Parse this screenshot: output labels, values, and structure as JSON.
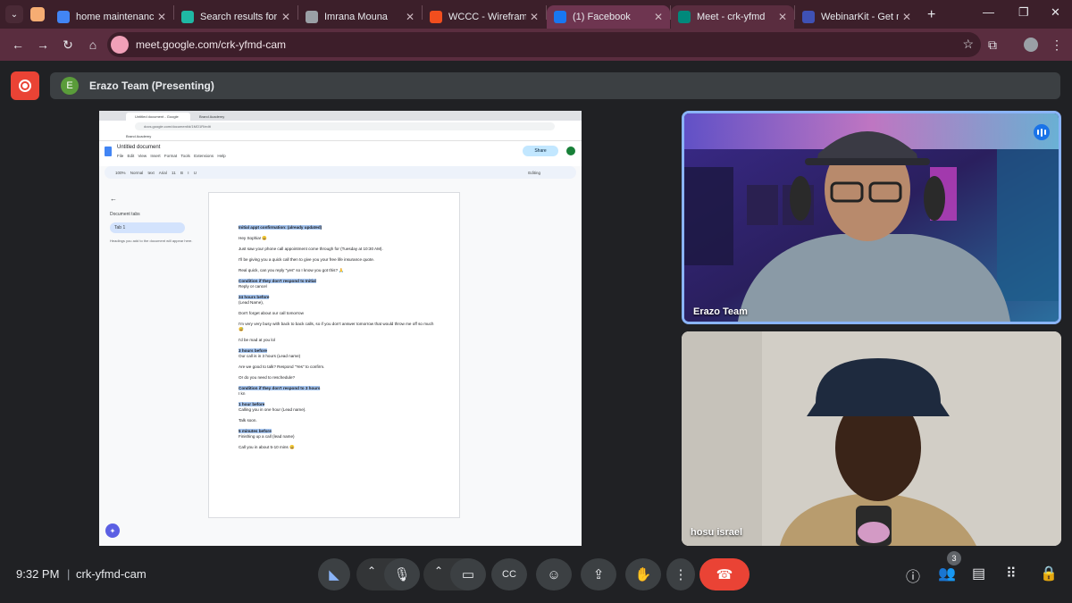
{
  "browser": {
    "tabs": [
      {
        "title": "home maintenance",
        "favicon_color": "#4285f4",
        "state": "normal"
      },
      {
        "title": "Search results for A",
        "favicon_color": "#1fb8a4",
        "state": "normal"
      },
      {
        "title": "Imrana Mouna",
        "favicon_color": "#9aa0a6",
        "state": "normal"
      },
      {
        "title": "WCCC - Wireframe",
        "favicon_color": "#f24e1e",
        "state": "normal"
      },
      {
        "title": "(1) Facebook",
        "favicon_color": "#1877f2",
        "state": "highlighted"
      },
      {
        "title": "Meet - crk-yfmd",
        "favicon_color": "#00897b",
        "state": "active"
      },
      {
        "title": "WebinarKit - Get m",
        "favicon_color": "#3f51b5",
        "state": "normal"
      }
    ],
    "url": "meet.google.com/crk-yfmd-cam"
  },
  "meet": {
    "presenter_initial": "E",
    "presenter_title": "Erazo Team (Presenting)",
    "participants": [
      {
        "name": "Erazo Team",
        "speaking": true
      },
      {
        "name": "hosu israel",
        "speaking": false
      }
    ],
    "time": "9:32 PM",
    "meeting_code": "crk-yfmd-cam",
    "people_count": "3",
    "accent_color": "#8ab4f8",
    "hangup_color": "#ea4335"
  },
  "shared_doc": {
    "browser_tabs": [
      "Untitled document - Google",
      "Brand Academy"
    ],
    "url": "docs.google.com/document/d/1MO1R/edit",
    "bookmark": "Brand Academy",
    "doc_title": "Untitled document",
    "menus": "File Edit View Insert Format Tools Extensions Help",
    "toolbar": "100%  Normal text  Arial  11  B I U",
    "share_label": "Share",
    "editing_label": "Editing",
    "side_tabs_label": "Document tabs",
    "side_tab": "Tab 1",
    "side_hint": "Headings you add to the document will appear here.",
    "paragraphs": [
      {
        "text": "Initial appt confirmation: (already updated)",
        "highlight": true
      },
      {
        "text": "Hey Sophia! 😀"
      },
      {
        "text": "Just saw your phone call appointment come through for (Tuesday at 10:30 AM)."
      },
      {
        "text": "I'll be giving you a quick call then to give you your free life insurance quote."
      },
      {
        "text": "Real quick, can you reply \"yes\" so I know you got this? 🙏"
      },
      {
        "text": "Condition if they don't respond to Initial",
        "highlight": true,
        "sub": "Reply or cancel"
      },
      {
        "text": "24 hours before",
        "highlight": true,
        "sub": "(Lead Name),"
      },
      {
        "text": "Don't forget about our call tomorrow"
      },
      {
        "text": "I'm very very busy with back to back calls, so if you don't answer tomorrow that would throw me off so much 😅"
      },
      {
        "text": "I'd be mad at you lol"
      },
      {
        "text": "3 hours before",
        "highlight": true,
        "sub": "Our call is in 3 hours (Lead name)"
      },
      {
        "text": "Are we good to talk? Respond \"Yes\" to confirm."
      },
      {
        "text": "Or do you need to reschedule?"
      },
      {
        "text": "Condition if they don't respond to 3 hours",
        "highlight": true,
        "sub": "I kn"
      },
      {
        "text": "1 hour before",
        "highlight": true,
        "sub": "Calling you in one hour (Lead name)."
      },
      {
        "text": "Talk soon."
      },
      {
        "text": "5 minutes before",
        "highlight": true,
        "sub": "Finishing up a call (lead name)"
      },
      {
        "text": "Call you in about 5-10 mins 😀"
      }
    ]
  }
}
